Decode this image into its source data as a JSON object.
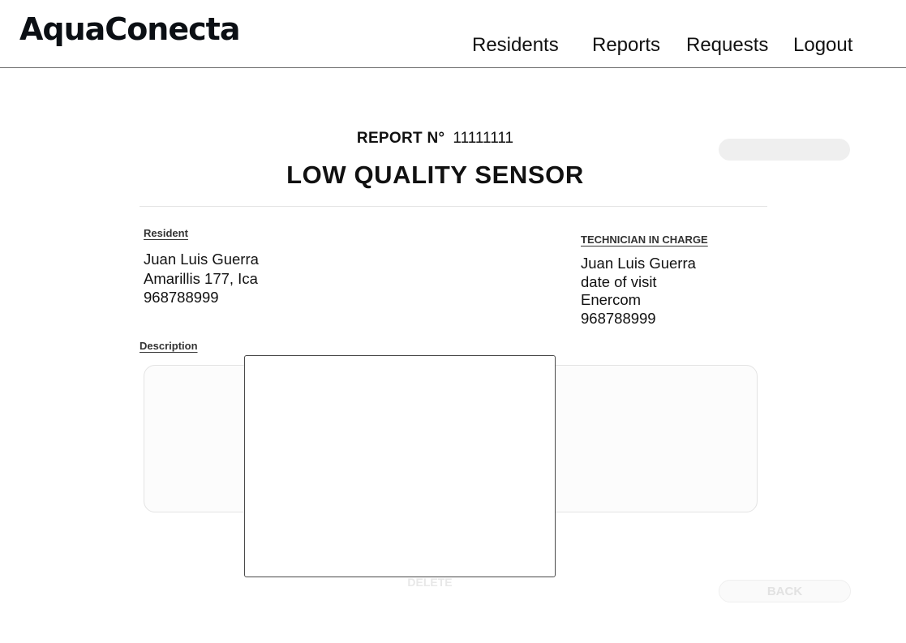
{
  "app": {
    "logo": "AquaConecta"
  },
  "nav": {
    "residents": "Residents",
    "reports": "Reports",
    "requests": "Requests",
    "logout": "Logout"
  },
  "report": {
    "number_label": "REPORT N°",
    "number": "11111111",
    "title": "LOW QUALITY SENSOR",
    "status": ""
  },
  "resident": {
    "label": "Resident",
    "name": "Juan Luis Guerra",
    "address": "Amarillis 177, Ica",
    "phone": "968788999"
  },
  "technician": {
    "label": "TECHNICIAN IN CHARGE",
    "name": "Juan Luis Guerra",
    "visit": "date of visit",
    "company": "Enercom",
    "phone": "968788999"
  },
  "description": {
    "label": "Description",
    "text": ""
  },
  "actions": {
    "delete": "DELETE",
    "back": "BACK"
  }
}
